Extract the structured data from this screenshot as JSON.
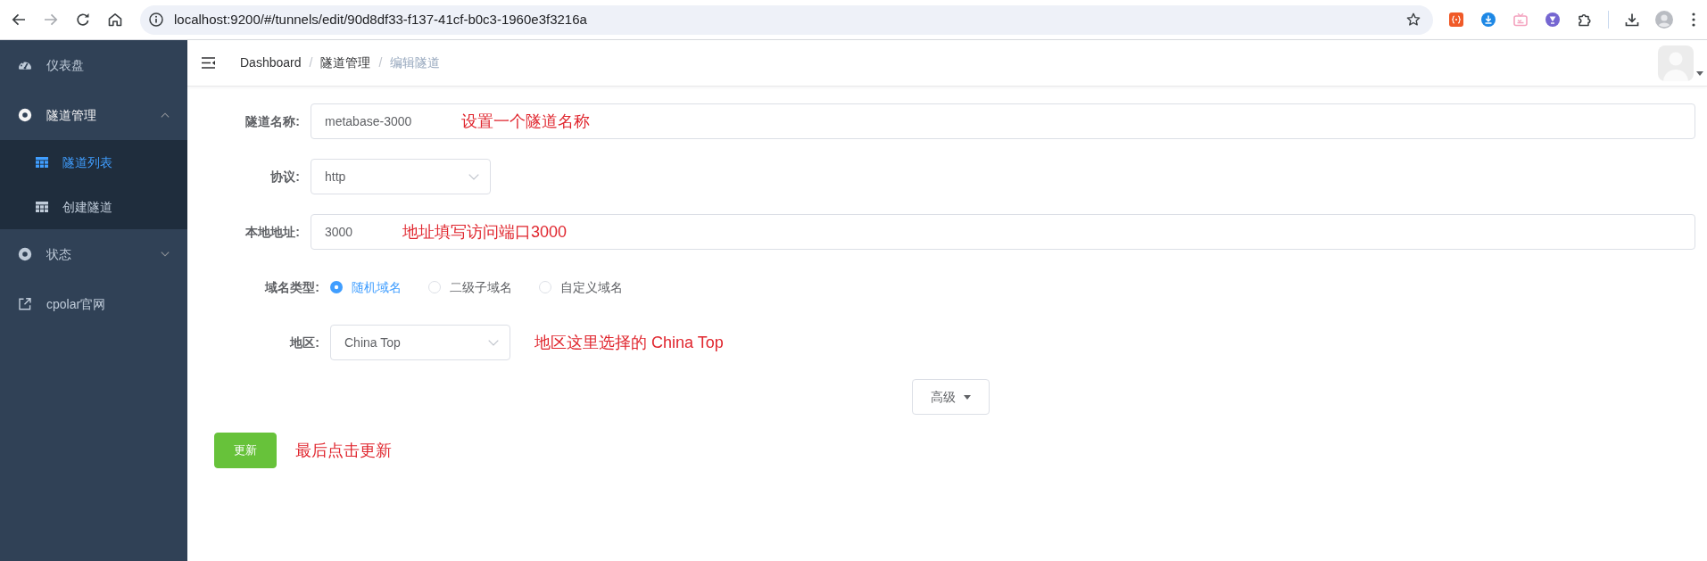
{
  "browser": {
    "nav": [
      {
        "kind": "back",
        "disabled": false
      },
      {
        "kind": "forward",
        "disabled": true
      },
      {
        "kind": "reload",
        "disabled": false
      },
      {
        "kind": "home",
        "disabled": false
      }
    ],
    "url": "localhost:9200/#/tunnels/edit/90d8df33-f137-41cf-b0c3-1960e3f3216a"
  },
  "sidebar": {
    "items": [
      {
        "label": "仪表盘",
        "kind": "dashboard",
        "selected": false
      },
      {
        "label": "隧道管理",
        "kind": "group",
        "selected": false,
        "expanded": true,
        "children": [
          {
            "label": "隧道列表",
            "selected": true
          },
          {
            "label": "创建隧道",
            "selected": false
          }
        ]
      },
      {
        "label": "状态",
        "kind": "group",
        "selected": false,
        "expanded": false
      },
      {
        "label": "cpolar官网",
        "kind": "external",
        "selected": false
      }
    ]
  },
  "header": {
    "breadcrumb": {
      "separator": "/",
      "items": [
        {
          "label": "Dashboard",
          "current": false
        },
        {
          "label": "隧道管理",
          "current": false
        },
        {
          "label": "编辑隧道",
          "current": true
        }
      ]
    }
  },
  "form": {
    "fields": [
      {
        "kind": "text",
        "label": "隧道名称:",
        "value": "metabase-3000",
        "note": "设置一个隧道名称"
      },
      {
        "kind": "select",
        "label": "协议:",
        "value": "http"
      },
      {
        "kind": "text",
        "label": "本地地址:",
        "value": "3000",
        "note": "地址填写访问端口3000"
      }
    ],
    "domain_fields": [
      {
        "kind": "radio",
        "label": "域名类型:",
        "options": [
          {
            "label": "随机域名",
            "selected": true
          },
          {
            "label": "二级子域名",
            "selected": false
          },
          {
            "label": "自定义域名",
            "selected": false
          }
        ]
      },
      {
        "kind": "select",
        "label": "地区:",
        "value": "China Top",
        "note": "地区这里选择的 China Top"
      }
    ],
    "advanced_button": "高级",
    "submit_button": "更新",
    "submit_note": "最后点击更新"
  }
}
